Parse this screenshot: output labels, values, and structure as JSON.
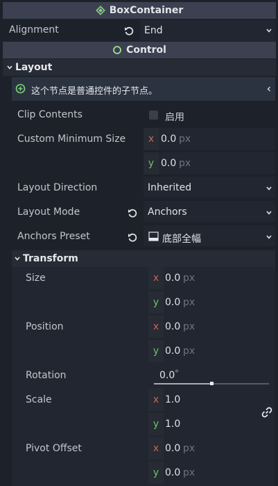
{
  "box_container": {
    "title": "BoxContainer"
  },
  "alignment": {
    "label": "Alignment",
    "value": "End"
  },
  "control": {
    "title": "Control"
  },
  "layout": {
    "title": "Layout",
    "info": "这个节点是普通控件的子节点。",
    "clip_contents": {
      "label": "Clip Contents",
      "checkbox_label": "启用"
    },
    "custom_min_size": {
      "label": "Custom Minimum Size",
      "x_axis": "x",
      "x": "0.0",
      "y_axis": "y",
      "y": "0.0",
      "unit": "px"
    },
    "layout_direction": {
      "label": "Layout Direction",
      "value": "Inherited"
    },
    "layout_mode": {
      "label": "Layout Mode",
      "value": "Anchors"
    },
    "anchors_preset": {
      "label": "Anchors Preset",
      "value": "底部全幅"
    }
  },
  "transform": {
    "title": "Transform",
    "size": {
      "label": "Size",
      "x": "0.0",
      "y": "0.0",
      "unit": "px"
    },
    "position": {
      "label": "Position",
      "x": "0.0",
      "y": "0.0",
      "unit": "px"
    },
    "rotation": {
      "label": "Rotation",
      "value": "0.0",
      "unit": "°",
      "slider_fraction": 0.5
    },
    "scale": {
      "label": "Scale",
      "x": "1.0",
      "y": "1.0"
    },
    "pivot_offset": {
      "label": "Pivot Offset",
      "x": "0.0",
      "y": "0.0",
      "unit": "px"
    }
  },
  "colors": {
    "accent": "#9fe08f",
    "x_axis": "#d1634f",
    "y_axis": "#6fc26a",
    "header": "#3b4150"
  }
}
